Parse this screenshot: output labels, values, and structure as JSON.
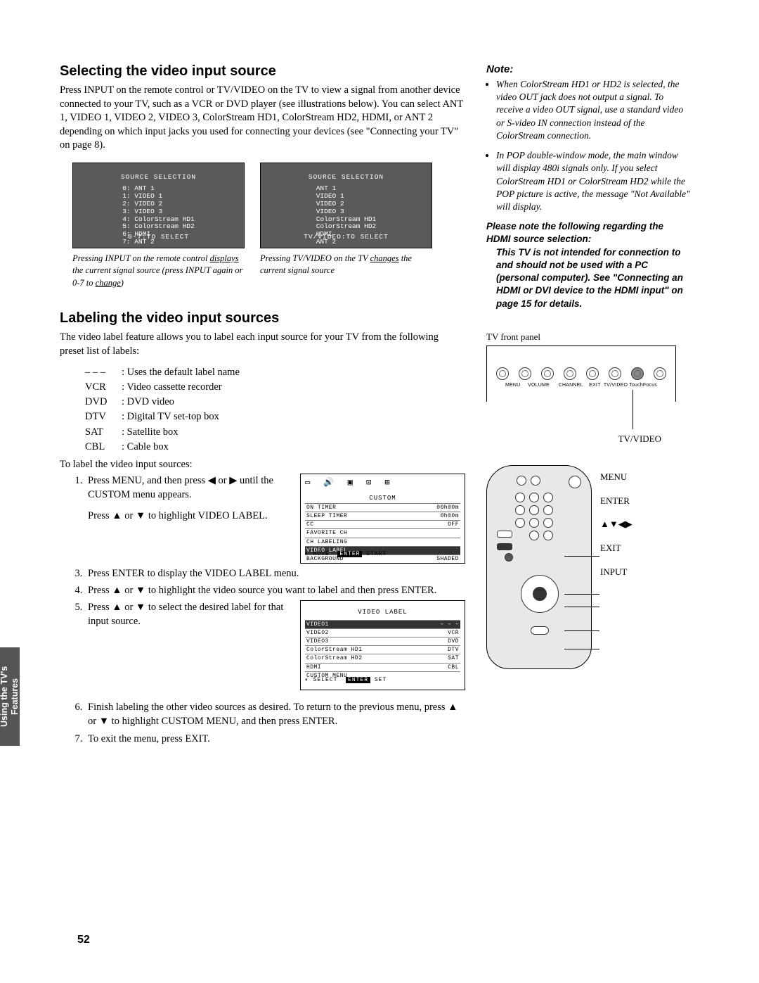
{
  "sideTab": "Using the TV's Features",
  "pageNumber": "52",
  "sectionA": {
    "heading": "Selecting the video input source",
    "body": "Press INPUT on the remote control or TV/VIDEO on the TV to view a signal from another device connected to your TV, such as a VCR or DVD player (see illustrations below). You can select ANT 1, VIDEO 1, VIDEO 2, VIDEO 3, ColorStream HD1, ColorStream HD2, HDMI, or ANT 2 depending on which input jacks you used for connecting your devices (see \"Connecting your TV\" on page 8)."
  },
  "osd1": {
    "title": "SOURCE SELECTION",
    "lines": [
      "0: ANT 1",
      "1: VIDEO 1",
      "2: VIDEO 2",
      "3: VIDEO 3",
      "4: ColorStream HD1",
      "5: ColorStream HD2",
      "6: HDMI",
      "7: ANT 2"
    ],
    "foot": "0-7:TO SELECT"
  },
  "osd2": {
    "title": "SOURCE SELECTION",
    "lines": [
      "ANT 1",
      "VIDEO 1",
      "VIDEO 2",
      "VIDEO 3",
      "ColorStream HD1",
      "ColorStream HD2",
      "HDMI",
      "ANT 2"
    ],
    "foot": "TV/VIDEO:TO SELECT"
  },
  "cap1a": "Pressing INPUT on the remote control ",
  "cap1b": "displays",
  "cap1c": " the current signal source (press INPUT again or 0-7 to ",
  "cap1d": "change",
  "cap1e": ")",
  "cap2a": "Pressing TV/VIDEO on the TV ",
  "cap2b": "changes",
  "cap2c": " the current signal source",
  "sectionB": {
    "heading": "Labeling the video input sources",
    "body": "The video label feature allows you to label each input source for your TV from the following preset list of labels:"
  },
  "labels": [
    {
      "k": "– – –",
      "v": ": Uses the default label name"
    },
    {
      "k": "VCR",
      "v": ": Video cassette recorder"
    },
    {
      "k": "DVD",
      "v": ": DVD video"
    },
    {
      "k": "DTV",
      "v": ": Digital TV set-top box"
    },
    {
      "k": "SAT",
      "v": ": Satellite box"
    },
    {
      "k": "CBL",
      "v": ": Cable box"
    }
  ],
  "stepsIntro": "To label the video input sources:",
  "steps": {
    "s1": "Press MENU, and then press ◀ or ▶ until the CUSTOM menu appears.",
    "s2": "Press ▲ or ▼ to highlight VIDEO LABEL.",
    "s3": "Press ENTER to display the VIDEO LABEL menu.",
    "s4": "Press ▲ or ▼ to highlight the video source you want to label and then press ENTER.",
    "s5": "Press ▲ or ▼ to select the desired label for that input source.",
    "s6": "Finish labeling the other video sources as desired. To return to the previous menu, press ▲ or ▼ to highlight CUSTOM MENU, and then press ENTER.",
    "s7": "To exit the menu, press EXIT."
  },
  "customMenu": {
    "title": "CUSTOM",
    "rows": [
      {
        "l": "ON TIMER",
        "r": "00h00m"
      },
      {
        "l": "SLEEP TIMER",
        "r": "0h00m"
      },
      {
        "l": "CC",
        "r": "OFF"
      },
      {
        "l": "FAVORITE CH",
        "r": ""
      },
      {
        "l": "CH LABELING",
        "r": ""
      },
      {
        "l": "VIDEO LABEL",
        "r": "",
        "hl": true
      },
      {
        "l": "BACKGROUND",
        "r": "SHADED"
      }
    ],
    "foot": {
      "move": "MOVE",
      "enter": "ENTER",
      "start": "START"
    }
  },
  "labelMenu": {
    "title": "VIDEO LABEL",
    "rows": [
      {
        "l": "VIDEO1",
        "r": "– – –",
        "hl": true
      },
      {
        "l": "VIDEO2",
        "r": "VCR"
      },
      {
        "l": "VIDEO3",
        "r": "DVD"
      },
      {
        "l": "ColorStream HD1",
        "r": "DTV"
      },
      {
        "l": "ColorStream HD2",
        "r": "SAT"
      },
      {
        "l": "HDMI",
        "r": "CBL"
      },
      {
        "l": "CUSTOM MENU",
        "r": ""
      }
    ],
    "foot": {
      "select": "SELECT",
      "enter": "ENTER",
      "set": "SET"
    }
  },
  "note": {
    "title": "Note:",
    "b1": "When ColorStream HD1 or HD2 is selected, the video OUT jack does not output a signal. To receive a video OUT signal, use a standard video or S-video IN connection instead of the ColorStream connection.",
    "b2": "In POP double-window mode, the main window will display 480i signals only. If you select ColorStream HD1 or ColorStream HD2 while the POP picture is active, the message \"Not Available\" will display.",
    "sub1": "Please note the following regarding the HDMI source selection:",
    "sub2": "This TV is not intended for connection to and should not be used with a PC (personal computer). See \"Connecting an HDMI or DVI device to the HDMI input\" on page 15 for details."
  },
  "frontPanel": {
    "label": "TV front panel",
    "buttons": [
      "MENU",
      "VOLUME",
      "",
      "CHANNEL",
      "",
      "EXIT",
      "TV/VIDEO",
      "TouchFocus"
    ],
    "callout": "TV/VIDEO"
  },
  "remoteCallouts": [
    "MENU",
    "ENTER",
    "▲▼◀▶",
    "EXIT",
    "INPUT"
  ]
}
